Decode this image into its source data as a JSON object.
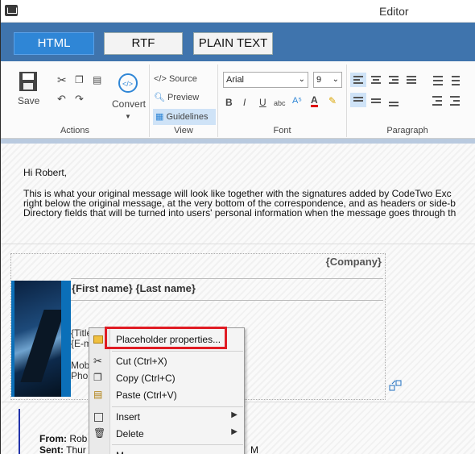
{
  "window": {
    "title": "Editor"
  },
  "modes": [
    {
      "label": "HTML",
      "active": true
    },
    {
      "label": "RTF",
      "active": false
    },
    {
      "label": "PLAIN TEXT",
      "active": false
    }
  ],
  "ribbon": {
    "actions": {
      "label": "Actions",
      "save": "Save",
      "convert": "Convert"
    },
    "view": {
      "label": "View",
      "source": "</> Source",
      "preview": "Preview",
      "guidelines": "Guidelines"
    },
    "font": {
      "label": "Font",
      "family": "Arial",
      "size": "9",
      "bold": "B",
      "italic": "I",
      "underline": "U",
      "strike": "abc"
    },
    "paragraph": {
      "label": "Paragraph"
    }
  },
  "message": {
    "greeting": "Hi Robert,",
    "line1": "This is what your original message will look like together with the signatures added by CodeTwo Exc",
    "line2": "right below the original message, at the very bottom of the correspondence, and as headers or side-b",
    "line3": "Directory fields that will be turned into users' personal information when the message goes through th"
  },
  "signature": {
    "company": "{Company}",
    "names": "{First name} {Last name}",
    "title": "{Title}",
    "email": "{E-m",
    "mobile": "Mob",
    "phone": "Pho"
  },
  "forwarded": {
    "from": "From:",
    "from_val": "Rob",
    "sent": "Sent:",
    "sent_val": "Thur",
    "tail": "M"
  },
  "context_menu": {
    "items": [
      {
        "label": "Placeholder properties..."
      },
      {
        "label": "Cut (Ctrl+X)"
      },
      {
        "label": "Copy (Ctrl+C)"
      },
      {
        "label": "Paste (Ctrl+V)"
      },
      {
        "label": "Insert"
      },
      {
        "label": "Delete"
      },
      {
        "label": "M"
      }
    ]
  },
  "colors": {
    "modebar": "#3f74ad",
    "active_mode": "#2f86d6",
    "highlight": "#e01c24"
  }
}
